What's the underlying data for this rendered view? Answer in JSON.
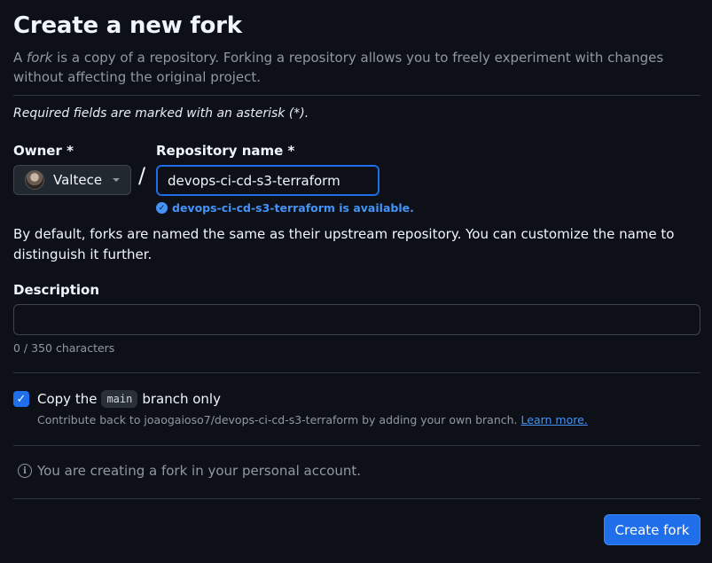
{
  "header": {
    "title": "Create a new fork",
    "subtitle_prefix": "A ",
    "subtitle_em": "fork",
    "subtitle_suffix": " is a copy of a repository. Forking a repository allows you to freely experiment with changes without affecting the original project."
  },
  "form": {
    "required_note": "Required fields are marked with an asterisk (*).",
    "owner": {
      "label": "Owner *",
      "value": "Valtece"
    },
    "separator": "/",
    "repo_name": {
      "label": "Repository name *",
      "value": "devops-ci-cd-s3-terraform",
      "availability": "devops-ci-cd-s3-terraform is available."
    },
    "naming_help": "By default, forks are named the same as their upstream repository. You can customize the name to distinguish it further.",
    "description": {
      "label": "Description",
      "value": "",
      "char_count": "0 / 350 characters"
    },
    "copy_branch": {
      "checked": true,
      "text_before": "Copy the",
      "branch": "main",
      "text_after": "branch only",
      "help": "Contribute back to joaogaioso7/devops-ci-cd-s3-terraform by adding your own branch.",
      "learn_more": "Learn more."
    },
    "info": "You are creating a fork in your personal account.",
    "submit_label": "Create fork"
  },
  "colors": {
    "background": "#0d1117",
    "accent": "#1f6feb",
    "link": "#4493f8",
    "muted": "#9198a1"
  }
}
